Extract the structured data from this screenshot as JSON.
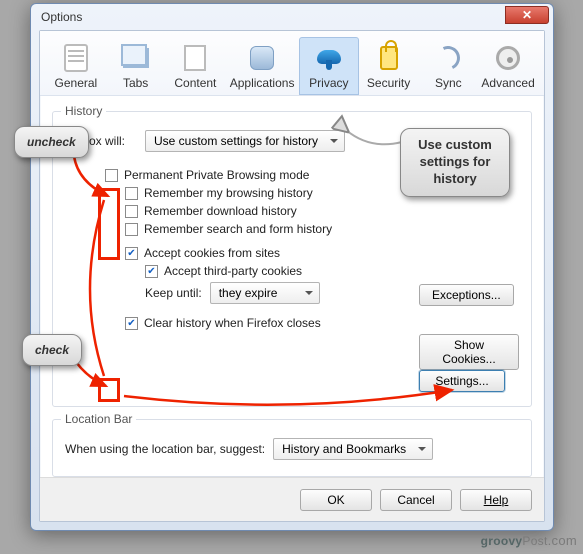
{
  "window": {
    "title": "Options"
  },
  "tabs": {
    "general": "General",
    "tabs": "Tabs",
    "content": "Content",
    "applications": "Applications",
    "privacy": "Privacy",
    "security": "Security",
    "sync": "Sync",
    "advanced": "Advanced",
    "selected": "privacy"
  },
  "history": {
    "group_title": "History",
    "will_label": "Firefox will:",
    "will_value": "Use custom settings for history",
    "ppb_label": "Permanent Private Browsing mode",
    "ppb_checked": false,
    "remember_browsing_label": "Remember my browsing history",
    "remember_browsing_checked": false,
    "remember_download_label": "Remember download history",
    "remember_download_checked": false,
    "remember_form_label": "Remember search and form history",
    "remember_form_checked": false,
    "accept_cookies_label": "Accept cookies from sites",
    "accept_cookies_checked": true,
    "accept_third_label": "Accept third-party cookies",
    "accept_third_checked": true,
    "keep_until_label": "Keep until:",
    "keep_until_value": "they expire",
    "clear_on_close_label": "Clear history when Firefox closes",
    "clear_on_close_checked": true,
    "exceptions_btn": "Exceptions...",
    "show_cookies_btn": "Show Cookies...",
    "settings_btn": "Settings..."
  },
  "locationbar": {
    "group_title": "Location Bar",
    "suggest_label": "When using the location bar, suggest:",
    "suggest_value": "History and Bookmarks"
  },
  "footer": {
    "ok": "OK",
    "cancel": "Cancel",
    "help": "Help"
  },
  "annotations": {
    "uncheck": "uncheck",
    "check": "check",
    "use_custom": "Use custom settings for history"
  },
  "watermark": "groovyPost.com"
}
